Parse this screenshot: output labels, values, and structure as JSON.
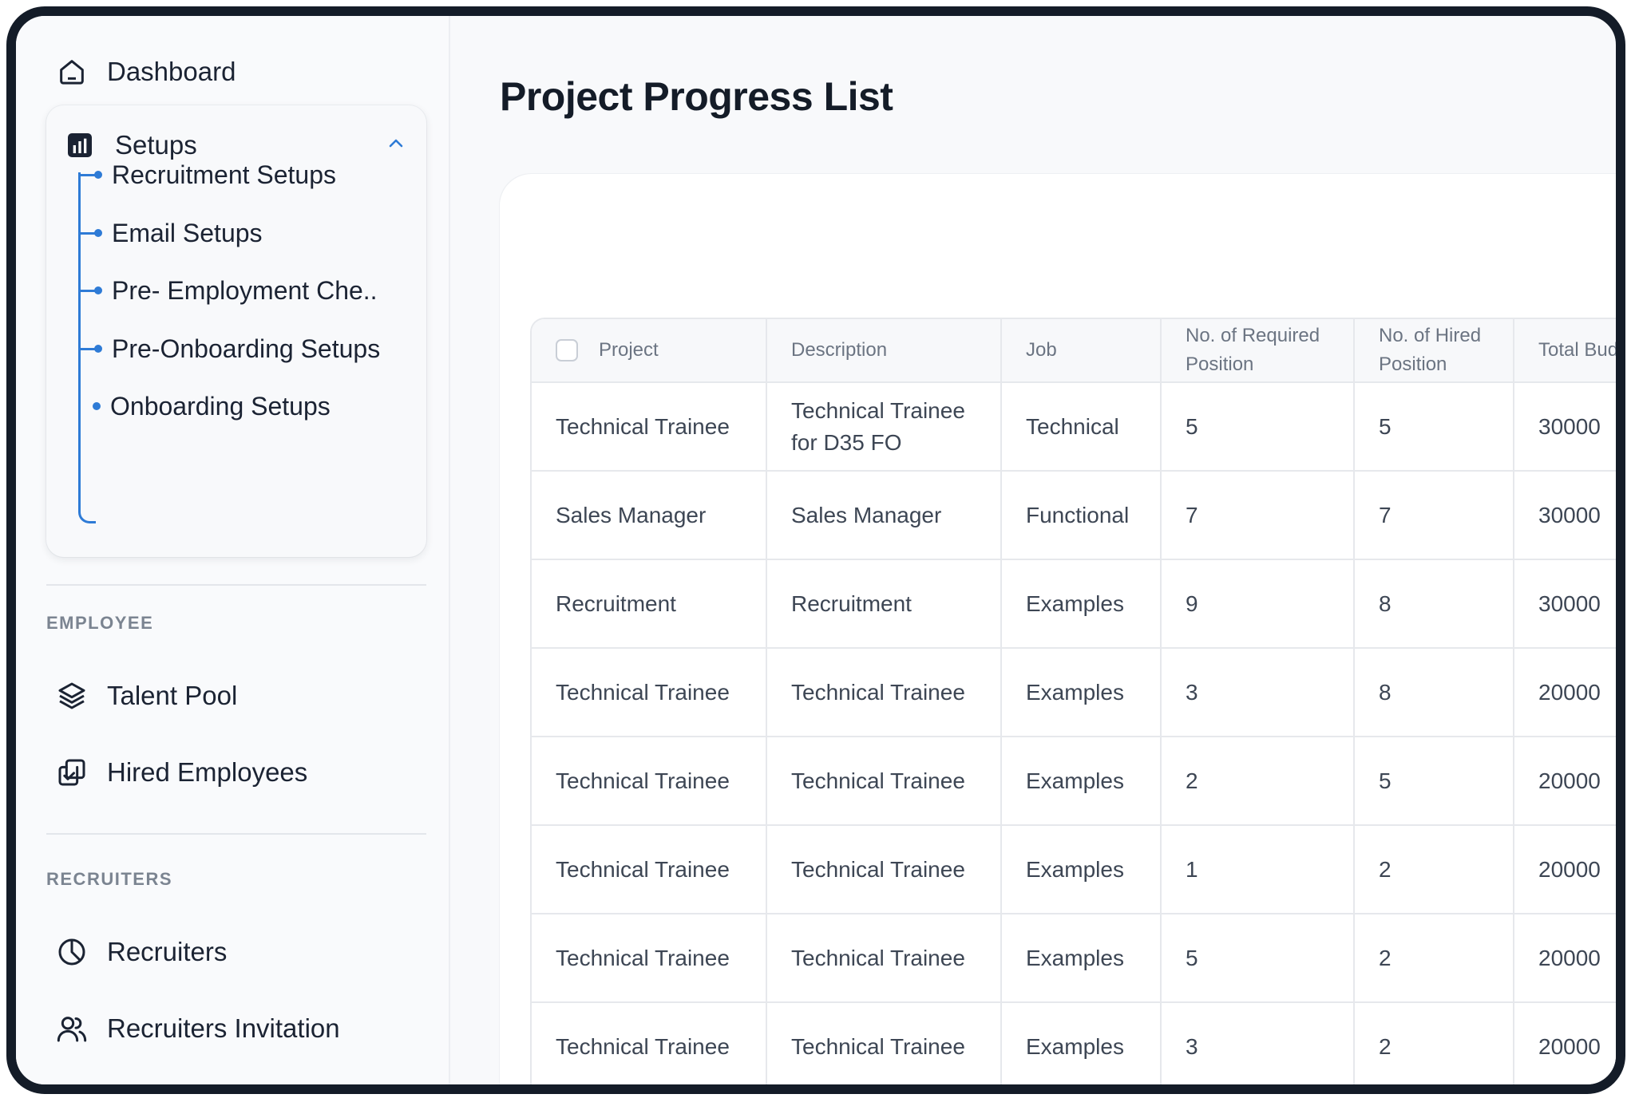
{
  "sidebar": {
    "dashboard": {
      "label": "Dashboard",
      "icon": "home-icon"
    },
    "setups": {
      "label": "Setups",
      "icon": "bar-chart-icon",
      "expanded": true,
      "items": [
        {
          "label": "Recruitment Setups"
        },
        {
          "label": "Email Setups"
        },
        {
          "label": "Pre- Employment Che.."
        },
        {
          "label": "Pre-Onboarding Setups"
        },
        {
          "label": "Onboarding Setups"
        }
      ]
    },
    "employee_section": {
      "label": "EMPLOYEE",
      "items": [
        {
          "label": "Talent Pool",
          "icon": "layers-icon"
        },
        {
          "label": "Hired Employees",
          "icon": "copy-check-icon"
        }
      ]
    },
    "recruiters_section": {
      "label": "RECRUITERS",
      "items": [
        {
          "label": "Recruiters",
          "icon": "pie-chart-icon"
        },
        {
          "label": "Recruiters Invitation",
          "icon": "users-icon"
        }
      ]
    }
  },
  "main": {
    "title": "Project Progress List",
    "table": {
      "headers": [
        "Project",
        "Description",
        "Job",
        "No. of Required Position",
        "No. of Hired Position",
        "Total Budg"
      ],
      "rows": [
        [
          "Technical Trainee",
          "Technical Trainee for D35 FO",
          "Technical",
          "5",
          "5",
          "30000"
        ],
        [
          "Sales Manager",
          "Sales Manager",
          "Functional",
          "7",
          "7",
          "30000"
        ],
        [
          "Recruitment",
          "Recruitment",
          "Examples",
          "9",
          "8",
          "30000"
        ],
        [
          "Technical Trainee",
          "Technical Trainee",
          "Examples",
          "3",
          "8",
          "20000"
        ],
        [
          "Technical Trainee",
          "Technical Trainee",
          "Examples",
          "2",
          "5",
          "20000"
        ],
        [
          "Technical Trainee",
          "Technical Trainee",
          "Examples",
          "1",
          "2",
          "20000"
        ],
        [
          "Technical Trainee",
          "Technical Trainee",
          "Examples",
          "5",
          "2",
          "20000"
        ],
        [
          "Technical Trainee",
          "Technical Trainee",
          "Examples",
          "3",
          "2",
          "20000"
        ]
      ]
    }
  },
  "colors": {
    "accent": "#2e7bd6",
    "frame": "#141c28",
    "text_dark": "#1b2333",
    "text_muted": "#6b7482"
  }
}
